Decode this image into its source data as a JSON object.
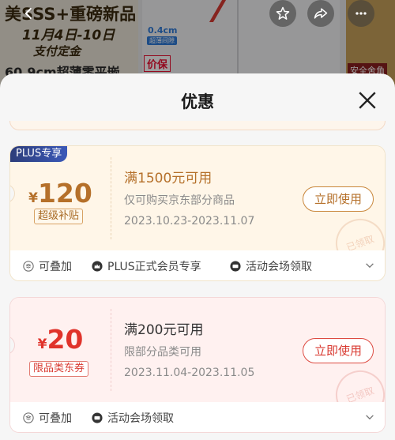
{
  "background": {
    "banner_line1": "美SSS+重磅新品",
    "banner_line2": "11月4日-10日",
    "banner_line3": "支付定金",
    "banner_line4": "60.9cm超薄零平嵌",
    "dimension": "0.4cm",
    "dimension_sub": "超薄间隙",
    "price_tag": "价保",
    "right_tag": "安全舍角"
  },
  "sheet": {
    "title": "优惠"
  },
  "coupons": [
    {
      "badge": "PLUS专享",
      "currency": "¥",
      "amount": "120",
      "amount_tag": "超级补贴",
      "title": "满1500元可用",
      "desc": "仅可购买京东部分商品",
      "date": "2023.10.23-2023.11.07",
      "button": "立即使用",
      "stamp": "已领取",
      "footer": [
        "可叠加",
        "PLUS正式会员专享",
        "活动会场领取"
      ]
    },
    {
      "currency": "¥",
      "amount": "20",
      "amount_tag": "限品类东券",
      "title": "满200元可用",
      "desc": "限部分品类可用",
      "date": "2023.11.04-2023.11.05",
      "button": "立即使用",
      "stamp": "已领取",
      "footer": [
        "可叠加",
        "活动会场领取"
      ]
    }
  ],
  "colors": {
    "gold": "#b5702a",
    "red": "#d93b32",
    "plus_blue": "#2d3d7a"
  }
}
